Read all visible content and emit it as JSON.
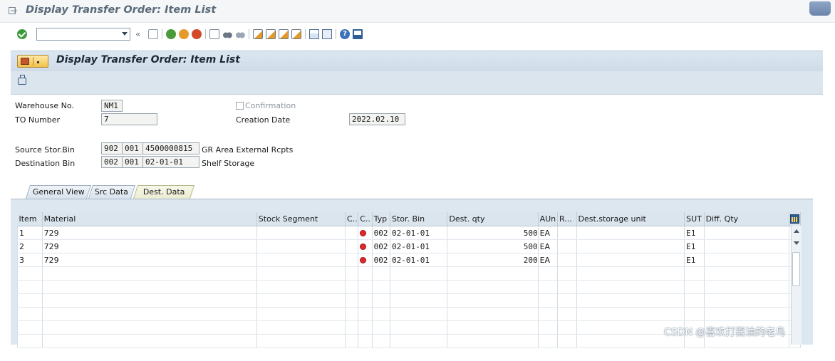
{
  "window": {
    "title": "Display Transfer Order: Item List"
  },
  "toolbar": {
    "command_value": ""
  },
  "screen": {
    "title": "Display Transfer Order: Item List"
  },
  "header": {
    "warehouse_label": "Warehouse No.",
    "warehouse_value": "NM1",
    "confirmation_label": "Confirmation",
    "to_number_label": "TO Number",
    "to_number_value": "7",
    "creation_date_label": "Creation Date",
    "creation_date_value": "2022.02.10",
    "source_bin_label": "Source Stor.Bin",
    "source_bin_type": "902",
    "source_bin_section": "001",
    "source_bin_number": "4500000815",
    "source_bin_desc": "GR Area External Rcpts",
    "dest_bin_label": "Destination Bin",
    "dest_bin_type": "002",
    "dest_bin_section": "001",
    "dest_bin_number": "02-01-01",
    "dest_bin_desc": "Shelf Storage"
  },
  "tabs": [
    "General View",
    "Src Data",
    "Dest. Data"
  ],
  "active_tab": "Dest. Data",
  "table": {
    "columns": [
      "Item",
      "Material",
      "Stock Segment",
      "C..",
      "C..",
      "Typ",
      "Stor. Bin",
      "Dest. qty",
      "AUn",
      "R...",
      "Dest.storage unit",
      "SUT",
      "Diff. Qty"
    ],
    "rows": [
      {
        "item": "1",
        "material": "729",
        "typ": "002",
        "bin": "02-01-01",
        "qty": "500",
        "aun": "EA",
        "sut": "E1"
      },
      {
        "item": "2",
        "material": "729",
        "typ": "002",
        "bin": "02-01-01",
        "qty": "500",
        "aun": "EA",
        "sut": "E1"
      },
      {
        "item": "3",
        "material": "729",
        "typ": "002",
        "bin": "02-01-01",
        "qty": "200",
        "aun": "EA",
        "sut": "E1"
      }
    ]
  },
  "watermark": "CSDN @喜欢打酱油的老鸟",
  "colors": {
    "status_red": "#e0282a",
    "header_blue": "#dbe5ee"
  }
}
